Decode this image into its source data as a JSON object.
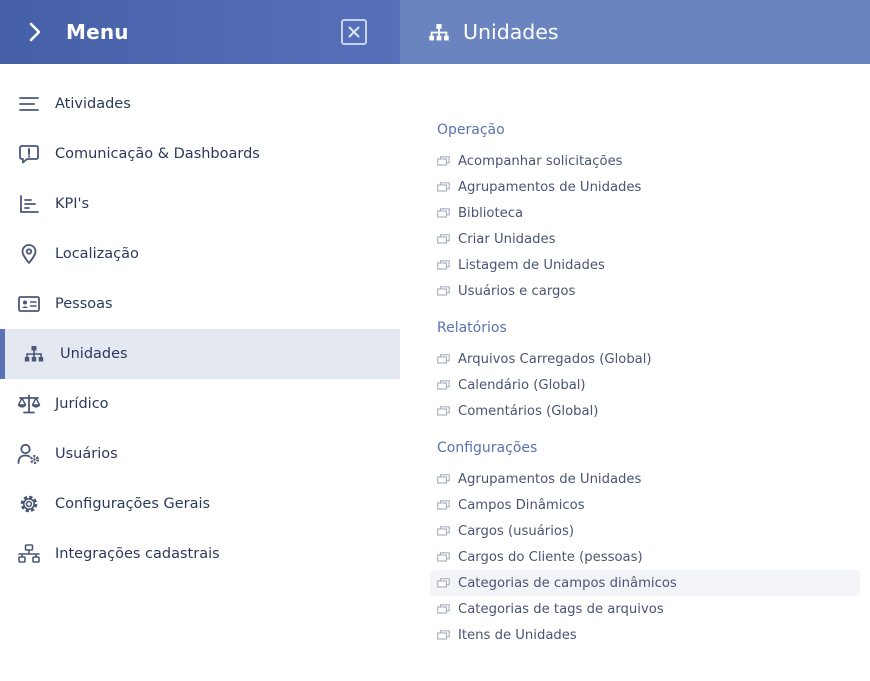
{
  "menu": {
    "title": "Menu",
    "items": [
      {
        "label": "Atividades"
      },
      {
        "label": "Comunicação & Dashboards"
      },
      {
        "label": "KPI's"
      },
      {
        "label": "Localização"
      },
      {
        "label": "Pessoas"
      },
      {
        "label": "Unidades"
      },
      {
        "label": "Jurídico"
      },
      {
        "label": "Usuários"
      },
      {
        "label": "Configurações Gerais"
      },
      {
        "label": "Integrações cadastrais"
      }
    ]
  },
  "panel": {
    "title": "Unidades",
    "sections": [
      {
        "title": "Operação",
        "links": [
          "Acompanhar solicitações",
          "Agrupamentos de Unidades",
          "Biblioteca",
          "Criar Unidades",
          "Listagem de Unidades",
          "Usuários e cargos"
        ]
      },
      {
        "title": "Relatórios",
        "links": [
          "Arquivos Carregados (Global)",
          "Calendário (Global)",
          "Comentários (Global)"
        ]
      },
      {
        "title": "Configurações",
        "links": [
          "Agrupamentos de Unidades",
          "Campos Dinâmicos",
          "Cargos (usuários)",
          "Cargos do Cliente (pessoas)",
          "Categorias de campos dinâmicos",
          "Categorias de tags de arquivos",
          "Itens de Unidades"
        ]
      }
    ]
  },
  "colors": {
    "menu_header": "#4660a8",
    "panel_header": "#6a84c0",
    "active_item_bg": "#e4e8f1",
    "accent": "#5a73b7"
  }
}
